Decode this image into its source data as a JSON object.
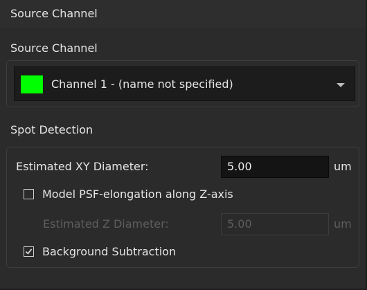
{
  "window": {
    "title": "Source Channel"
  },
  "source": {
    "label": "Source Channel",
    "channel": {
      "value": "Channel 1 - (name not specified)",
      "color": "#00ff00"
    }
  },
  "detection": {
    "label": "Spot Detection",
    "xy": {
      "label": "Estimated XY Diameter:",
      "value": "5.00",
      "unit": "um"
    },
    "psf": {
      "label": "Model PSF-elongation along Z-axis",
      "checked": false
    },
    "z": {
      "label": "Estimated Z Diameter:",
      "value": "5.00",
      "unit": "um",
      "enabled": false
    },
    "background": {
      "label": "Background Subtraction",
      "checked": true
    }
  }
}
